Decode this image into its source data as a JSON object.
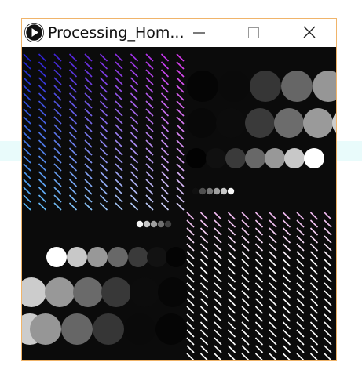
{
  "window": {
    "title": "Processing_Hom...",
    "app_icon": "processing-play-icon",
    "controls": [
      "minimize-icon",
      "maximize-icon",
      "close-icon"
    ]
  },
  "colors": {
    "frame_border": "#f0b46a",
    "canvas_bg": "#0b0b0b",
    "quad_top_left_start": "#1e1ed2",
    "quad_top_left_end": "#d838f0",
    "quad_top_left_bottom": "#58b8f8",
    "quad_bottom_right_top": "#f0b8f0",
    "quad_bottom_right_bottom": "#ffffff"
  }
}
